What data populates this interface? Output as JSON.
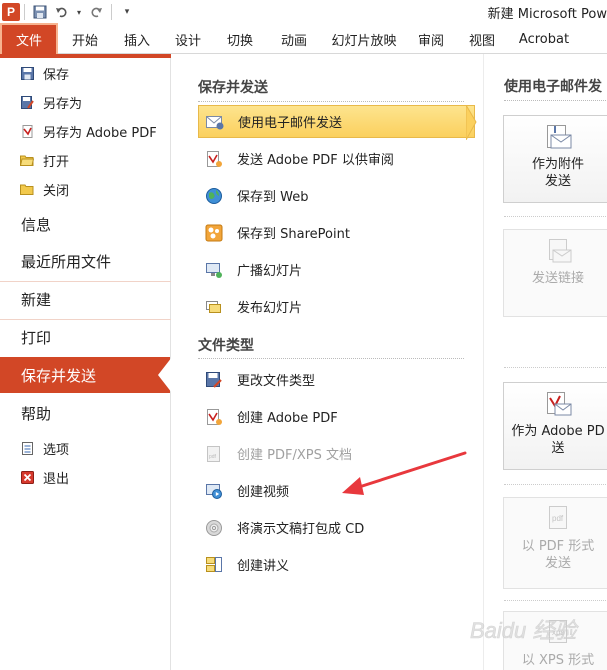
{
  "window": {
    "title": "新建 Microsoft Pow"
  },
  "qat": {
    "app_icon": "P"
  },
  "ribbon": {
    "file_tab": "文件",
    "tabs": [
      "开始",
      "插入",
      "设计",
      "切换",
      "动画",
      "幻灯片放映",
      "审阅",
      "视图",
      "Acrobat"
    ]
  },
  "leftnav": {
    "small_items": [
      {
        "label": "保存",
        "icon": "save-icon"
      },
      {
        "label": "另存为",
        "icon": "save-as-icon"
      },
      {
        "label": "另存为 Adobe PDF",
        "icon": "adobe-pdf-icon"
      },
      {
        "label": "打开",
        "icon": "open-folder-icon"
      },
      {
        "label": "关闭",
        "icon": "close-folder-icon"
      }
    ],
    "big_items": [
      "信息",
      "最近所用文件",
      "新建",
      "打印",
      "保存并发送",
      "帮助"
    ],
    "active": "保存并发送",
    "bottom_items": [
      {
        "label": "选项",
        "icon": "options-icon"
      },
      {
        "label": "退出",
        "icon": "exit-icon"
      }
    ]
  },
  "middle": {
    "section1_title": "保存并发送",
    "section1_items": [
      {
        "label": "使用电子邮件发送",
        "icon": "email-icon",
        "selected": true
      },
      {
        "label": "发送 Adobe PDF 以供审阅",
        "icon": "pdf-review-icon"
      },
      {
        "label": "保存到 Web",
        "icon": "globe-icon"
      },
      {
        "label": "保存到 SharePoint",
        "icon": "sharepoint-icon"
      },
      {
        "label": "广播幻灯片",
        "icon": "broadcast-icon"
      },
      {
        "label": "发布幻灯片",
        "icon": "publish-icon"
      }
    ],
    "section2_title": "文件类型",
    "section2_items": [
      {
        "label": "更改文件类型",
        "icon": "change-type-icon"
      },
      {
        "label": "创建 Adobe PDF",
        "icon": "create-pdf-icon"
      },
      {
        "label": "创建 PDF/XPS 文档",
        "icon": "pdf-xps-icon",
        "disabled": true
      },
      {
        "label": "创建视频",
        "icon": "video-icon"
      },
      {
        "label": "将演示文稿打包成 CD",
        "icon": "cd-icon"
      },
      {
        "label": "创建讲义",
        "icon": "handout-icon"
      }
    ]
  },
  "right": {
    "title": "使用电子邮件发",
    "cards": [
      {
        "lines": [
          "作为附件",
          "发送"
        ],
        "icon": "attachment-icon"
      },
      {
        "lines": [
          "发送链接"
        ],
        "icon": "link-icon",
        "disabled": true
      },
      {
        "lines": [
          "作为 Adobe PD",
          "送"
        ],
        "icon": "adobe-attach-icon"
      },
      {
        "lines": [
          "以 PDF 形式",
          "发送"
        ],
        "icon": "pdf-send-icon",
        "disabled": true
      },
      {
        "lines": [
          "以 XPS 形式"
        ],
        "icon": "xps-send-icon",
        "disabled": true
      }
    ]
  },
  "watermark": {
    "text": "Baidu 经验"
  },
  "colors": {
    "accent": "#d24726",
    "selection": "#fbd05e",
    "annotation": "#e8383d"
  }
}
